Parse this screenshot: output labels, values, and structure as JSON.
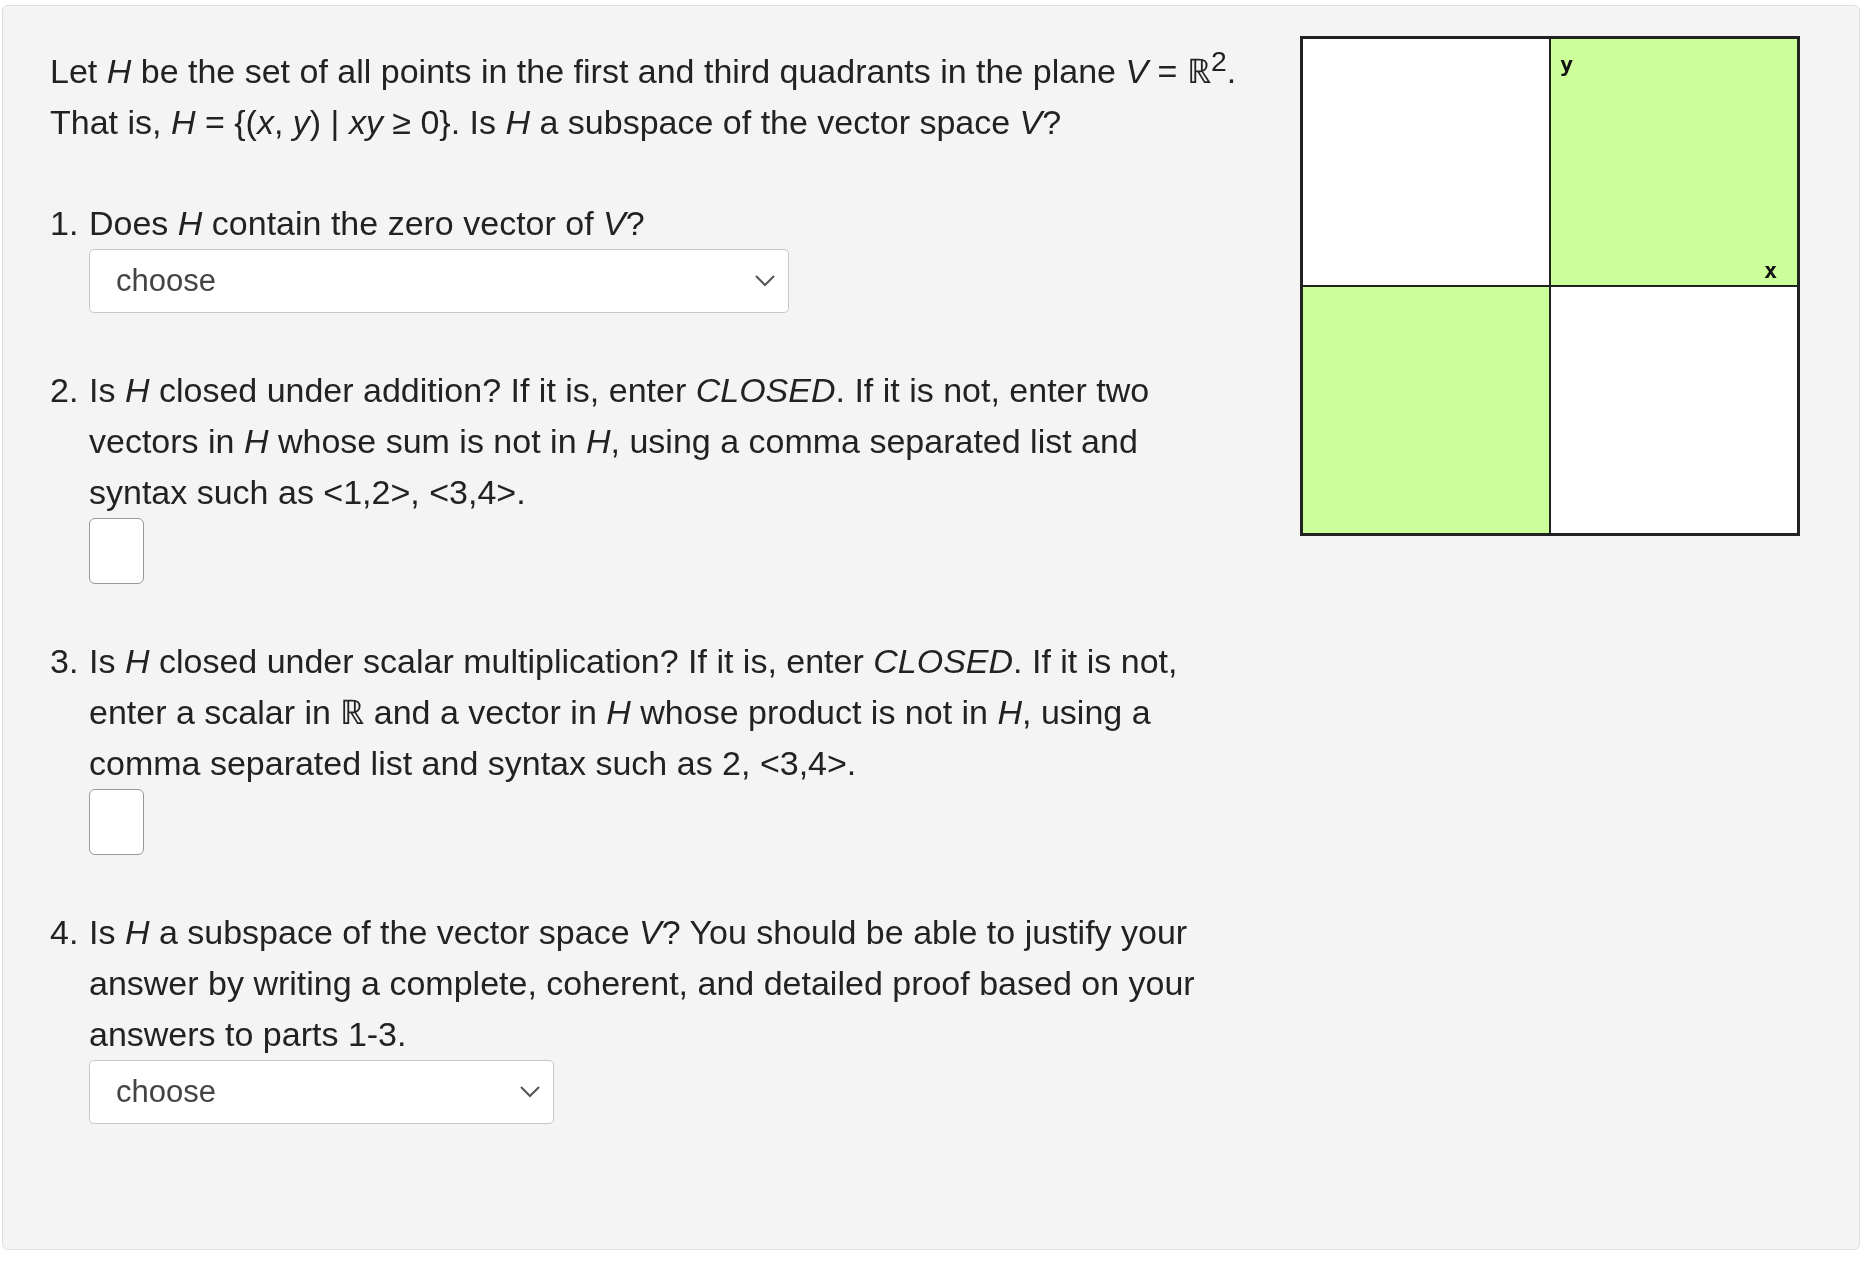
{
  "intro": "Let *H* be the set of all points in the first and third quadrants in the plane *V* = ℝ$^{2}$. That is, *H* = {(*x*, *y*) | *xy* ≥ 0}. Is *H* a subspace of the vector space *V*?",
  "questions": [
    {
      "number": "1.",
      "text": "Does *H* contain the zero vector of *V*?",
      "kind": "select",
      "value": "choose"
    },
    {
      "number": "2.",
      "text": "Is *H* closed under addition? If it is, enter *CLOSED*. If it is not, enter two vectors in *H* whose sum is not in *H*, using a comma separated list and syntax such as <1,2>, <3,4>.",
      "kind": "input"
    },
    {
      "number": "3.",
      "text": "Is *H* closed under scalar multiplication? If it is, enter *CLOSED*. If it is not, enter a scalar in ℝ and a vector in *H* whose product is not in *H*, using a comma separated list and syntax such as 2, <3,4>.",
      "kind": "input"
    },
    {
      "number": "4.",
      "text": "Is *H* a subspace of the vector space *V*? You should be able to justify your answer by writing a complete, coherent, and detailed proof based on your answers to parts 1-3.",
      "kind": "select_short",
      "value": "choose"
    }
  ],
  "graph": {
    "quadrants": [
      {
        "shaded": false
      },
      {
        "shaded": true
      },
      {
        "shaded": true
      },
      {
        "shaded": false
      }
    ],
    "y_label": "y",
    "x_label": "x"
  }
}
